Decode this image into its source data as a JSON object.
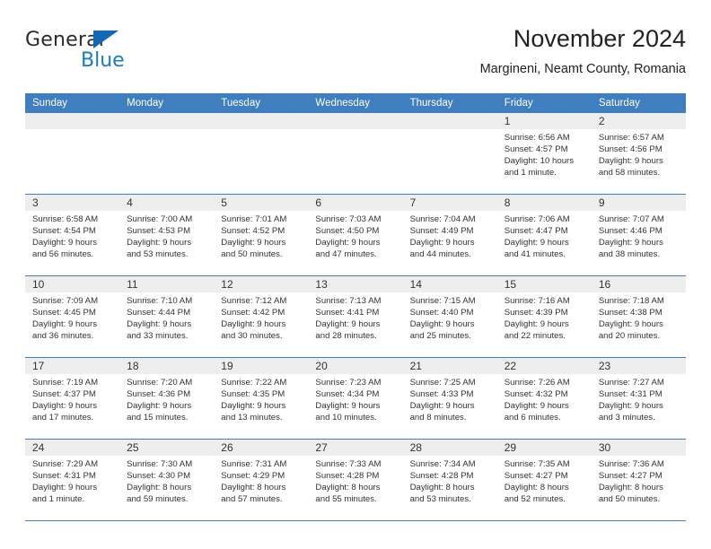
{
  "brand": {
    "name_part1": "General",
    "name_part2": "Blue",
    "triangle_icon": "triangle-logo-icon",
    "accent_color": "#1a7cc4"
  },
  "header": {
    "title": "November 2024",
    "subtitle": "Margineni, Neamt County, Romania"
  },
  "colors": {
    "header_row_blue": "#3f7fbf",
    "day_band_gray": "#eeeeee",
    "text": "#333333"
  },
  "weekdays": [
    "Sunday",
    "Monday",
    "Tuesday",
    "Wednesday",
    "Thursday",
    "Friday",
    "Saturday"
  ],
  "weeks": [
    [
      {
        "day": "",
        "lines": []
      },
      {
        "day": "",
        "lines": []
      },
      {
        "day": "",
        "lines": []
      },
      {
        "day": "",
        "lines": []
      },
      {
        "day": "",
        "lines": []
      },
      {
        "day": "1",
        "lines": [
          "Sunrise: 6:56 AM",
          "Sunset: 4:57 PM",
          "Daylight: 10 hours",
          "and 1 minute."
        ]
      },
      {
        "day": "2",
        "lines": [
          "Sunrise: 6:57 AM",
          "Sunset: 4:56 PM",
          "Daylight: 9 hours",
          "and 58 minutes."
        ]
      }
    ],
    [
      {
        "day": "3",
        "lines": [
          "Sunrise: 6:58 AM",
          "Sunset: 4:54 PM",
          "Daylight: 9 hours",
          "and 56 minutes."
        ]
      },
      {
        "day": "4",
        "lines": [
          "Sunrise: 7:00 AM",
          "Sunset: 4:53 PM",
          "Daylight: 9 hours",
          "and 53 minutes."
        ]
      },
      {
        "day": "5",
        "lines": [
          "Sunrise: 7:01 AM",
          "Sunset: 4:52 PM",
          "Daylight: 9 hours",
          "and 50 minutes."
        ]
      },
      {
        "day": "6",
        "lines": [
          "Sunrise: 7:03 AM",
          "Sunset: 4:50 PM",
          "Daylight: 9 hours",
          "and 47 minutes."
        ]
      },
      {
        "day": "7",
        "lines": [
          "Sunrise: 7:04 AM",
          "Sunset: 4:49 PM",
          "Daylight: 9 hours",
          "and 44 minutes."
        ]
      },
      {
        "day": "8",
        "lines": [
          "Sunrise: 7:06 AM",
          "Sunset: 4:47 PM",
          "Daylight: 9 hours",
          "and 41 minutes."
        ]
      },
      {
        "day": "9",
        "lines": [
          "Sunrise: 7:07 AM",
          "Sunset: 4:46 PM",
          "Daylight: 9 hours",
          "and 38 minutes."
        ]
      }
    ],
    [
      {
        "day": "10",
        "lines": [
          "Sunrise: 7:09 AM",
          "Sunset: 4:45 PM",
          "Daylight: 9 hours",
          "and 36 minutes."
        ]
      },
      {
        "day": "11",
        "lines": [
          "Sunrise: 7:10 AM",
          "Sunset: 4:44 PM",
          "Daylight: 9 hours",
          "and 33 minutes."
        ]
      },
      {
        "day": "12",
        "lines": [
          "Sunrise: 7:12 AM",
          "Sunset: 4:42 PM",
          "Daylight: 9 hours",
          "and 30 minutes."
        ]
      },
      {
        "day": "13",
        "lines": [
          "Sunrise: 7:13 AM",
          "Sunset: 4:41 PM",
          "Daylight: 9 hours",
          "and 28 minutes."
        ]
      },
      {
        "day": "14",
        "lines": [
          "Sunrise: 7:15 AM",
          "Sunset: 4:40 PM",
          "Daylight: 9 hours",
          "and 25 minutes."
        ]
      },
      {
        "day": "15",
        "lines": [
          "Sunrise: 7:16 AM",
          "Sunset: 4:39 PM",
          "Daylight: 9 hours",
          "and 22 minutes."
        ]
      },
      {
        "day": "16",
        "lines": [
          "Sunrise: 7:18 AM",
          "Sunset: 4:38 PM",
          "Daylight: 9 hours",
          "and 20 minutes."
        ]
      }
    ],
    [
      {
        "day": "17",
        "lines": [
          "Sunrise: 7:19 AM",
          "Sunset: 4:37 PM",
          "Daylight: 9 hours",
          "and 17 minutes."
        ]
      },
      {
        "day": "18",
        "lines": [
          "Sunrise: 7:20 AM",
          "Sunset: 4:36 PM",
          "Daylight: 9 hours",
          "and 15 minutes."
        ]
      },
      {
        "day": "19",
        "lines": [
          "Sunrise: 7:22 AM",
          "Sunset: 4:35 PM",
          "Daylight: 9 hours",
          "and 13 minutes."
        ]
      },
      {
        "day": "20",
        "lines": [
          "Sunrise: 7:23 AM",
          "Sunset: 4:34 PM",
          "Daylight: 9 hours",
          "and 10 minutes."
        ]
      },
      {
        "day": "21",
        "lines": [
          "Sunrise: 7:25 AM",
          "Sunset: 4:33 PM",
          "Daylight: 9 hours",
          "and 8 minutes."
        ]
      },
      {
        "day": "22",
        "lines": [
          "Sunrise: 7:26 AM",
          "Sunset: 4:32 PM",
          "Daylight: 9 hours",
          "and 6 minutes."
        ]
      },
      {
        "day": "23",
        "lines": [
          "Sunrise: 7:27 AM",
          "Sunset: 4:31 PM",
          "Daylight: 9 hours",
          "and 3 minutes."
        ]
      }
    ],
    [
      {
        "day": "24",
        "lines": [
          "Sunrise: 7:29 AM",
          "Sunset: 4:31 PM",
          "Daylight: 9 hours",
          "and 1 minute."
        ]
      },
      {
        "day": "25",
        "lines": [
          "Sunrise: 7:30 AM",
          "Sunset: 4:30 PM",
          "Daylight: 8 hours",
          "and 59 minutes."
        ]
      },
      {
        "day": "26",
        "lines": [
          "Sunrise: 7:31 AM",
          "Sunset: 4:29 PM",
          "Daylight: 8 hours",
          "and 57 minutes."
        ]
      },
      {
        "day": "27",
        "lines": [
          "Sunrise: 7:33 AM",
          "Sunset: 4:28 PM",
          "Daylight: 8 hours",
          "and 55 minutes."
        ]
      },
      {
        "day": "28",
        "lines": [
          "Sunrise: 7:34 AM",
          "Sunset: 4:28 PM",
          "Daylight: 8 hours",
          "and 53 minutes."
        ]
      },
      {
        "day": "29",
        "lines": [
          "Sunrise: 7:35 AM",
          "Sunset: 4:27 PM",
          "Daylight: 8 hours",
          "and 52 minutes."
        ]
      },
      {
        "day": "30",
        "lines": [
          "Sunrise: 7:36 AM",
          "Sunset: 4:27 PM",
          "Daylight: 8 hours",
          "and 50 minutes."
        ]
      }
    ]
  ]
}
